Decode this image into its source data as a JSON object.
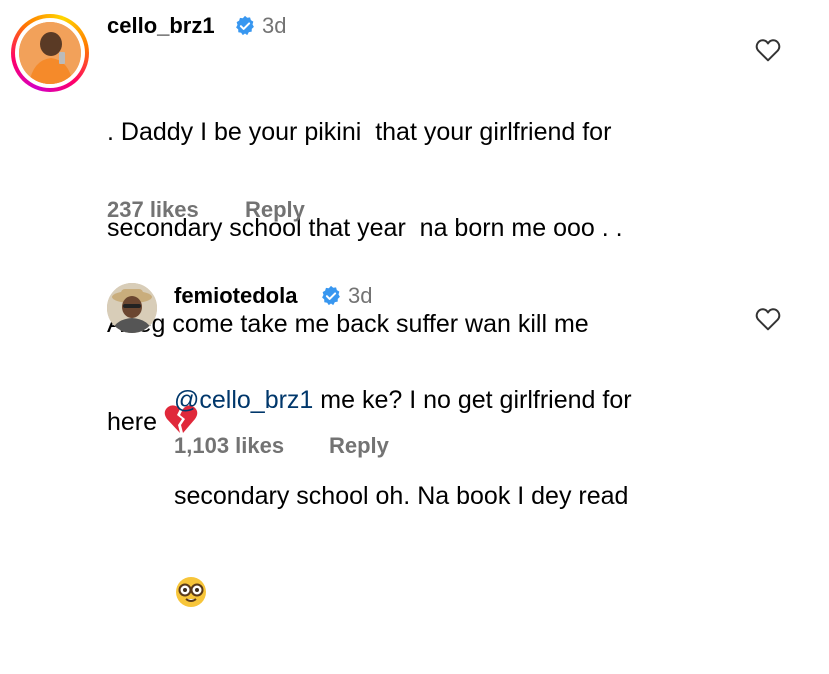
{
  "comment": {
    "username": "cello_brz1",
    "time": "3d",
    "text_lines": [
      ". Daddy I be your pikini  that your girlfriend for",
      "secondary school that year  na born me ooo . .",
      "Abeg come take me back suffer wan kill me",
      "here"
    ],
    "emoji": "broken-heart-emoji",
    "likes": "237 likes",
    "reply_label": "Reply"
  },
  "reply": {
    "username": "femiotedola",
    "time": "3d",
    "mention": "@cello_brz1",
    "text_lines": [
      " me ke? I no get girlfriend for",
      "secondary school oh. Na book I dey read"
    ],
    "emoji": "nerd-face-emoji",
    "likes": "1,103 likes",
    "reply_label": "Reply"
  },
  "icons": {
    "verified_color": "#3897f0",
    "like": "heart-outline-icon"
  }
}
